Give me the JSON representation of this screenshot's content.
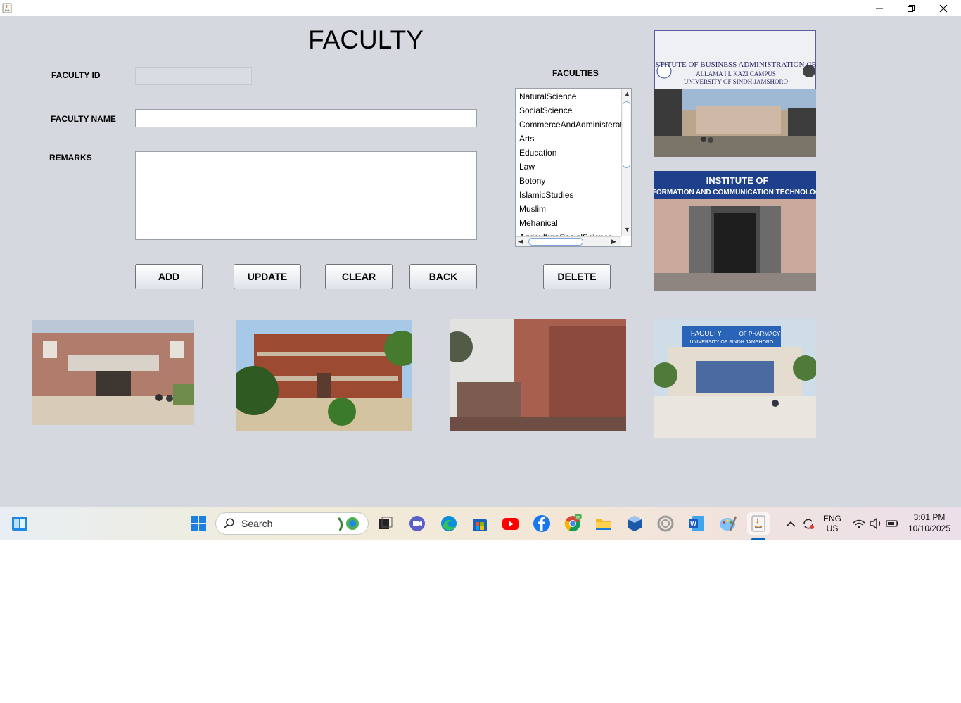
{
  "window": {
    "controls": {
      "minimize": "—",
      "maximize": "❐",
      "close": "✕"
    }
  },
  "form": {
    "title": "FACULTY",
    "faculty_id_label": "FACULTY ID",
    "faculty_id_value": "",
    "faculty_name_label": "FACULTY NAME",
    "faculty_name_value": "",
    "remarks_label": "REMARKS",
    "remarks_value": "",
    "list_heading": "FACULTIES"
  },
  "faculties": [
    "NaturalScience",
    "SocialScience",
    "CommerceAndAdministeration",
    "Arts",
    "Education",
    "Law",
    "Botony",
    "IslamicStudies",
    "Muslim",
    "Mehanical",
    "AgricultureSocialScience"
  ],
  "buttons": {
    "add": "ADD",
    "update": "UPDATE",
    "clear": "CLEAR",
    "back": "BACK",
    "delete": "DELETE"
  },
  "images": {
    "iba_sign_line1": "INSTITUTE OF BUSINESS ADMINISTRATION (IBA)",
    "iba_sign_line2": "ALLAMA I.I. KAZI CAMPUS",
    "iba_sign_line3": "UNIVERSITY OF SINDH JAMSHORO",
    "iict_sign_line1": "INSTITUTE OF",
    "iict_sign_line2": "INFORMATION AND COMMUNICATION TECHNOLOGY",
    "pharmacy_sign_line1": "FACULTY",
    "pharmacy_sign_line2": "OF PHARMACY",
    "pharmacy_sign_line3": "UNIVERSITY OF SINDH JAMSHORO"
  },
  "taskbar": {
    "search_placeholder": "Search",
    "lang_line1": "ENG",
    "lang_line2": "US",
    "time": "3:01 PM",
    "date": "10/10/2025",
    "chrome_badge": "m"
  },
  "colors": {
    "window_bg": "#d5d8df",
    "accent": "#0067c0"
  }
}
